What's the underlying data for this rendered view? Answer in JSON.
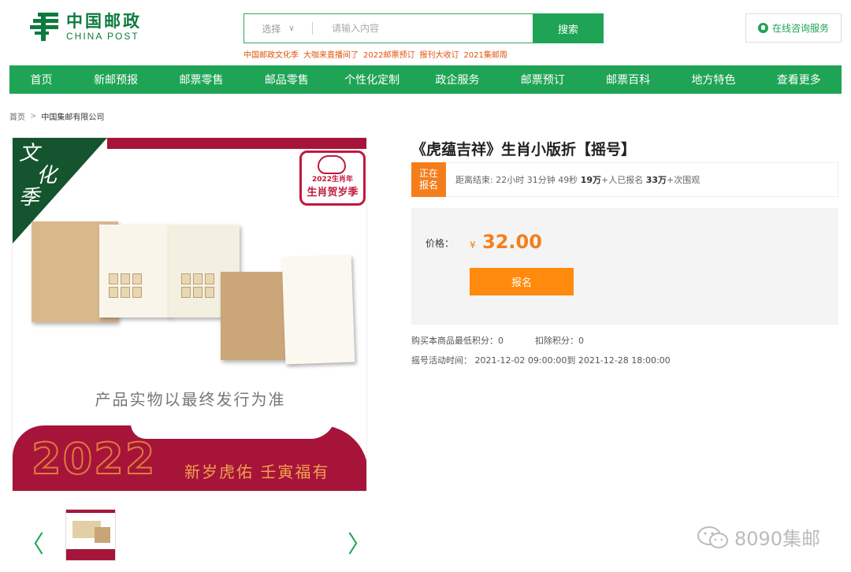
{
  "header": {
    "logo_cn": "中国邮政",
    "logo_en": "CHINA POST",
    "search": {
      "select_label": "选择",
      "placeholder": "请输入内容",
      "button_label": "搜索"
    },
    "hotwords": [
      "中国邮政文化季",
      "大咖来直播间了",
      "2022邮票预订",
      "报刊大收订",
      "2021集邮周"
    ],
    "consult_label": "在线咨询服务"
  },
  "nav": {
    "items": [
      "首页",
      "新邮预报",
      "邮票零售",
      "邮品零售",
      "个性化定制",
      "政企服务",
      "邮票预订",
      "邮票百科",
      "地方特色",
      "查看更多"
    ]
  },
  "breadcrumb": {
    "home": "首页",
    "current": "中国集邮有限公司"
  },
  "product": {
    "image": {
      "corner_text": [
        "文",
        "化",
        "季"
      ],
      "badge_year": "2022生肖年",
      "badge_title": "生肖贺岁季",
      "disclaimer": "产品实物以最终发行为准",
      "year": "2022",
      "slogan": "新岁虎佑 壬寅福有"
    },
    "title": "《虎蕴吉祥》生肖小版折【摇号】",
    "status": {
      "badge": "正在报名",
      "countdown_prefix": "距离结束: 22小时 31分钟 49秒",
      "signups": "19万",
      "signups_suffix": "+人已报名",
      "views": "33万",
      "views_suffix": "+次围观"
    },
    "price_label": "价格：",
    "currency": "¥",
    "price": "32.00",
    "signup_button": "报名",
    "min_points": "购买本商品最低积分：0",
    "deduct_points": "扣除积分：0",
    "period": "摇号活动时间： 2021-12-02 09:00:00到 2021-12-28 18:00:00"
  },
  "gallery": {
    "prev": "〈",
    "next": "〉"
  },
  "watermark": "8090集邮",
  "colors": {
    "brand_green": "#1fa456",
    "accent_orange": "#ff8a0d",
    "festive_red": "#a6143a"
  }
}
